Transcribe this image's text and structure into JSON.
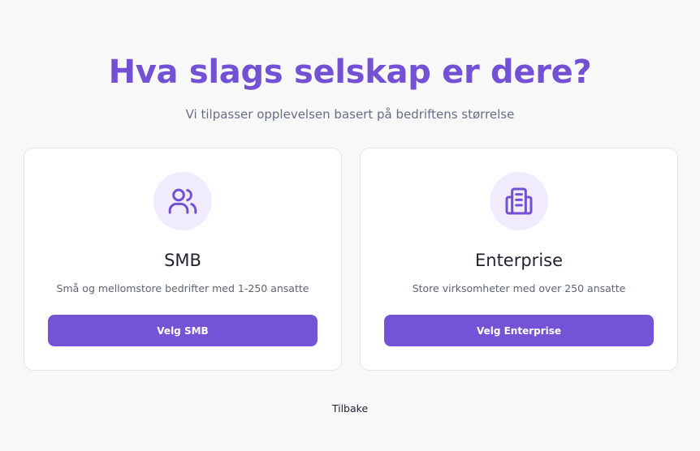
{
  "header": {
    "title": "Hva slags selskap er dere?",
    "subtitle": "Vi tilpasser opplevelsen basert på bedriftens størrelse"
  },
  "options": [
    {
      "icon": "users-icon",
      "title": "SMB",
      "description": "Små og mellomstore bedrifter med 1-250 ansatte",
      "button_label": "Velg SMB"
    },
    {
      "icon": "building-icon",
      "title": "Enterprise",
      "description": "Store virksomheter med over 250 ansatte",
      "button_label": "Velg Enterprise"
    }
  ],
  "footer": {
    "back_label": "Tilbake"
  },
  "colors": {
    "accent": "#7553d6",
    "icon_bg": "#f1ecfd",
    "background": "#f8f8f9"
  }
}
